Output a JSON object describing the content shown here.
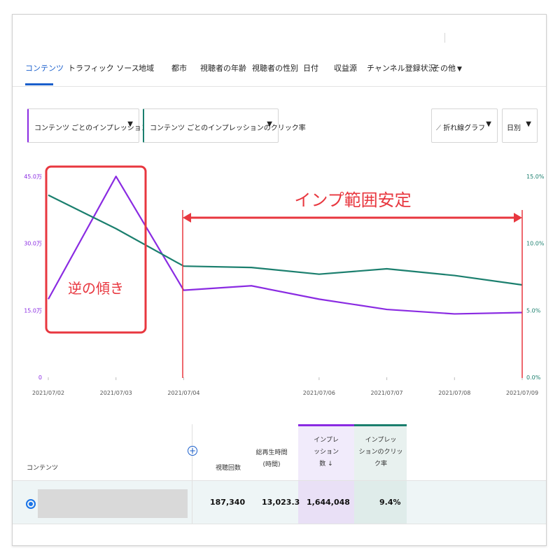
{
  "tabs": [
    {
      "label": "コンテンツ",
      "active": true
    },
    {
      "label": "トラフィック ソース"
    },
    {
      "label": "地域"
    },
    {
      "label": "都市"
    },
    {
      "label": "視聴者の年齢"
    },
    {
      "label": "視聴者の性別"
    },
    {
      "label": "日付"
    },
    {
      "label": "収益源"
    },
    {
      "label": "チャンネル登録状況"
    },
    {
      "label": "その他",
      "dropdown": true
    }
  ],
  "controls": {
    "metric1": "コンテンツ ごとのインプレッション数",
    "metric1_color": "#8a2be2",
    "metric2": "コンテンツ ごとのインプレッションのクリック率",
    "metric2_color": "#1b7f6e",
    "chart_type": "折れ線グラフ",
    "period": "日別",
    "arrow": "▼"
  },
  "chart_data": {
    "type": "line",
    "x": [
      "2021/07/02",
      "2021/07/03",
      "2021/07/04",
      "2021/07/06",
      "2021/07/07",
      "2021/07/08",
      "2021/07/09"
    ],
    "x_numeric": [
      0,
      1,
      2,
      4,
      5,
      6,
      7
    ],
    "left_axis": {
      "ticks": [
        "0",
        "15.0万",
        "30.0万",
        "45.0万"
      ],
      "ylim": [
        0,
        450000
      ],
      "color": "#8a2be2"
    },
    "right_axis": {
      "ticks": [
        "0.0%",
        "5.0%",
        "10.0%",
        "15.0%"
      ],
      "ylim": [
        0,
        15
      ],
      "color": "#1b7f6e"
    },
    "series": [
      {
        "values": [
          175000,
          450000,
          195000,
          205000,
          175000,
          152000,
          142000,
          145000
        ],
        "x_numeric": [
          0,
          1,
          2,
          3,
          4,
          5,
          6,
          7
        ],
        "color": "#8a2be2",
        "axis": "left"
      },
      {
        "values": [
          13.6,
          11.1,
          8.3,
          8.2,
          7.7,
          8.1,
          7.6,
          6.9
        ],
        "x_numeric": [
          0,
          1,
          2,
          3,
          4,
          5,
          6,
          7
        ],
        "color": "#1b7f6e",
        "axis": "right"
      }
    ],
    "grid": false
  },
  "annotations": {
    "left_box_label": "逆の傾き",
    "range_label": "インプ範囲安定",
    "color": "#e8373f"
  },
  "table": {
    "headers": {
      "content": "コンテンツ",
      "views": "視聴回数",
      "watch_time": [
        "総再生時間",
        "(時間)"
      ],
      "impressions": [
        "インプレ",
        "ッション",
        "数 ↓"
      ],
      "ctr": [
        "インプレッ",
        "ションのクリッ",
        "ク率"
      ]
    },
    "plus_icon": "+",
    "row": {
      "views": "187,340",
      "watch_time": "13,023.3",
      "impressions": "1,644,048",
      "ctr": "9.4%"
    }
  }
}
